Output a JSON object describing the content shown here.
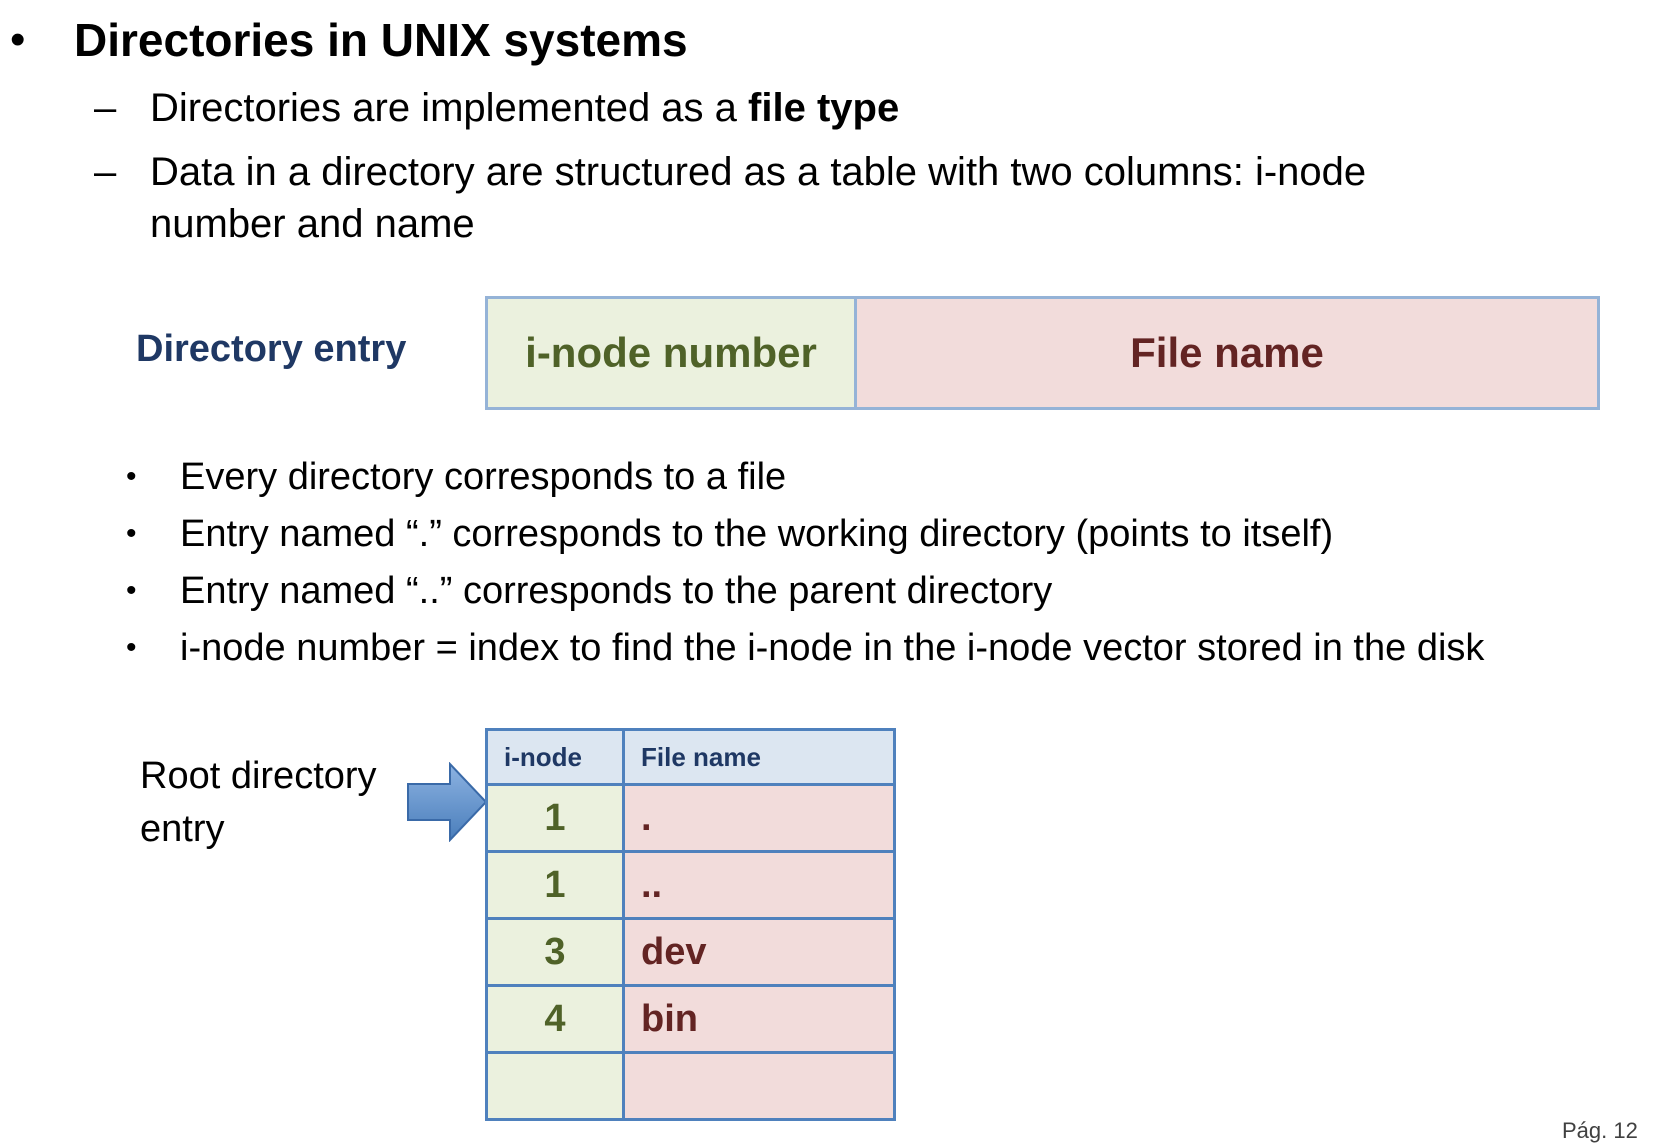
{
  "heading": {
    "bullet": "•",
    "title": "Directories in UNIX systems"
  },
  "dash_items": [
    {
      "mark": "–",
      "text_plain": "Directories are implemented as a ",
      "text_bold": "file type"
    },
    {
      "mark": "–",
      "line1": "Data in a directory are structured as a table with two columns: i-node",
      "line2": "number and name"
    }
  ],
  "directory_entry": {
    "label": "Directory entry",
    "inode_field": "i-node number",
    "name_field": "File name"
  },
  "sub_bullets": [
    {
      "dot": "•",
      "text": "Every directory corresponds to a file"
    },
    {
      "dot": "•",
      "text": "Entry named “.” corresponds to the working directory (points to itself)"
    },
    {
      "dot": "•",
      "text": "Entry named “..” corresponds to the parent directory"
    },
    {
      "dot": "•",
      "text": "i-node number = index to find the i-node in the i-node vector stored in the disk"
    }
  ],
  "root_label": "Root directory entry",
  "dir_table": {
    "headers": [
      "i-node",
      "File name"
    ],
    "rows": [
      {
        "inode": "1",
        "name": "."
      },
      {
        "inode": "1",
        "name": ".."
      },
      {
        "inode": "3",
        "name": "dev"
      },
      {
        "inode": "4",
        "name": "bin"
      },
      {
        "inode": "",
        "name": ""
      }
    ]
  },
  "page_number": "Pág. 12",
  "colors": {
    "accent_blue": "#1f3864",
    "table_border": "#4f81bd",
    "inode_bg": "#ebf1de",
    "name_bg": "#f2dcdb",
    "inode_text": "#4f6228",
    "name_text": "#632423",
    "arrow_fill": "#5b9bd5"
  }
}
